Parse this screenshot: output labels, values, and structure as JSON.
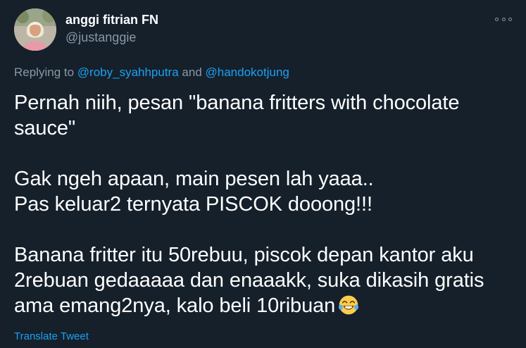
{
  "author": {
    "name": "anggi fitrian FN",
    "handle": "@justanggie"
  },
  "reply": {
    "prefix": "Replying to ",
    "mention_1": "@roby_syahhputra",
    "joiner": " and ",
    "mention_2": "@handokotjung"
  },
  "tweet": {
    "paragraph_1": "Pernah niih, pesan \"banana fritters with chocolate sauce\"",
    "paragraph_2": "Gak ngeh apaan, main pesen lah yaaa..\nPas keluar2 ternyata PISCOK dooong!!!",
    "paragraph_3": "Banana fritter itu 50rebuu, piscok depan kantor aku 2rebuan gedaaaaa dan enaaakk, suka dikasih gratis ama emang2nya, kalo beli 10ribuan",
    "emoji": "face-with-tears-of-joy-icon"
  },
  "actions": {
    "translate": "Translate Tweet",
    "more_icon": "more-options-icon"
  },
  "colors": {
    "background": "#15202b",
    "text": "#ffffff",
    "secondary": "#8899a6",
    "accent": "#1da1f2"
  }
}
